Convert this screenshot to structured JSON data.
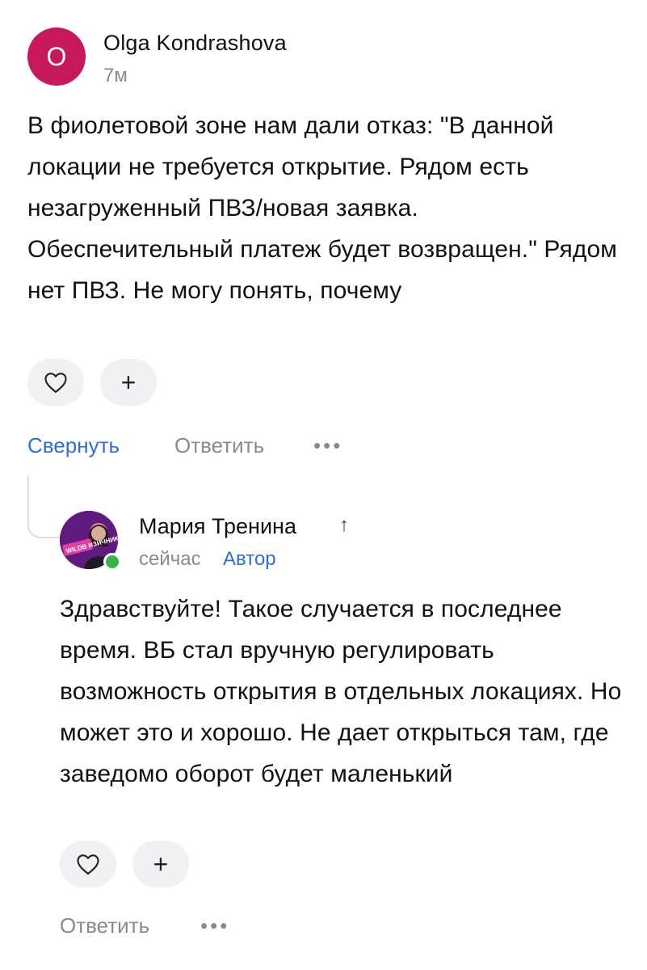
{
  "comment": {
    "avatar_letter": "O",
    "author": "Olga Kondrashova",
    "time": "7м",
    "text": "В фиолетовой зоне нам дали отказ: \"В данной локации не требуется открытие. Рядом есть незагруженный ПВЗ/новая заявка. Обеспечительный платеж будет возвращен.\" Рядом нет ПВЗ. Не могу понять, почему",
    "actions": {
      "collapse": "Свернуть",
      "reply": "Ответить",
      "more": "•••",
      "plus": "+"
    }
  },
  "reply": {
    "author": "Мария Тренина",
    "arrow": "↑",
    "time": "сейчас",
    "badge": "Автор",
    "avatar_text": "WILDB ИЗИЧНИКИ",
    "text": "Здравствуйте! Такое случается в последнее время. ВБ стал вручную регулировать возможность открытия в отдельных локациях. Но может это и хорошо. Не дает открыться там, где заведомо оборот будет маленький",
    "actions": {
      "reply": "Ответить",
      "more": "•••",
      "plus": "+"
    }
  },
  "colors": {
    "avatar_o": "#c6185a",
    "link_blue": "#2f6fd8",
    "muted": "#8a8a8f",
    "online": "#36b24a"
  }
}
